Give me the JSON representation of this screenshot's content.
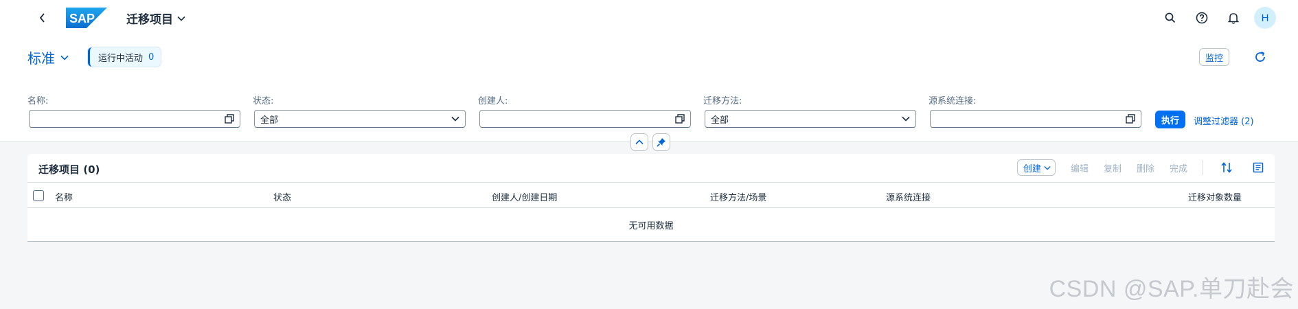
{
  "shell": {
    "logo_text": "SAP",
    "app_title": "迁移项目",
    "avatar_initial": "H"
  },
  "header": {
    "variant_label": "标准",
    "active_badge_label": "运行中活动",
    "active_badge_count": "0",
    "monitor_label": "监控"
  },
  "filters": [
    {
      "label": "名称:",
      "value": "",
      "icon": "value-help-icon"
    },
    {
      "label": "状态:",
      "value": "全部",
      "icon": "chevron-down-icon"
    },
    {
      "label": "创建人:",
      "value": "",
      "icon": "value-help-icon"
    },
    {
      "label": "迁移方法:",
      "value": "全部",
      "icon": "chevron-down-icon"
    },
    {
      "label": "源系统连接:",
      "value": "",
      "icon": "value-help-icon"
    }
  ],
  "filter_actions": {
    "go_label": "执行",
    "adapt_label": "调整过滤器 (2)"
  },
  "table": {
    "title": "迁移项目 (0)",
    "actions": {
      "create": "创建",
      "edit": "编辑",
      "copy": "复制",
      "delete": "删除",
      "complete": "完成"
    },
    "columns": [
      "名称",
      "状态",
      "创建人/创建日期",
      "迁移方法/场景",
      "源系统连接",
      "迁移对象数量"
    ],
    "no_data": "无可用数据"
  },
  "watermark": "CSDN @SAP.单刀赴会",
  "colors": {
    "accent": "#0064d9",
    "emphasized": "#0070f2",
    "background": "#f5f6f7"
  }
}
